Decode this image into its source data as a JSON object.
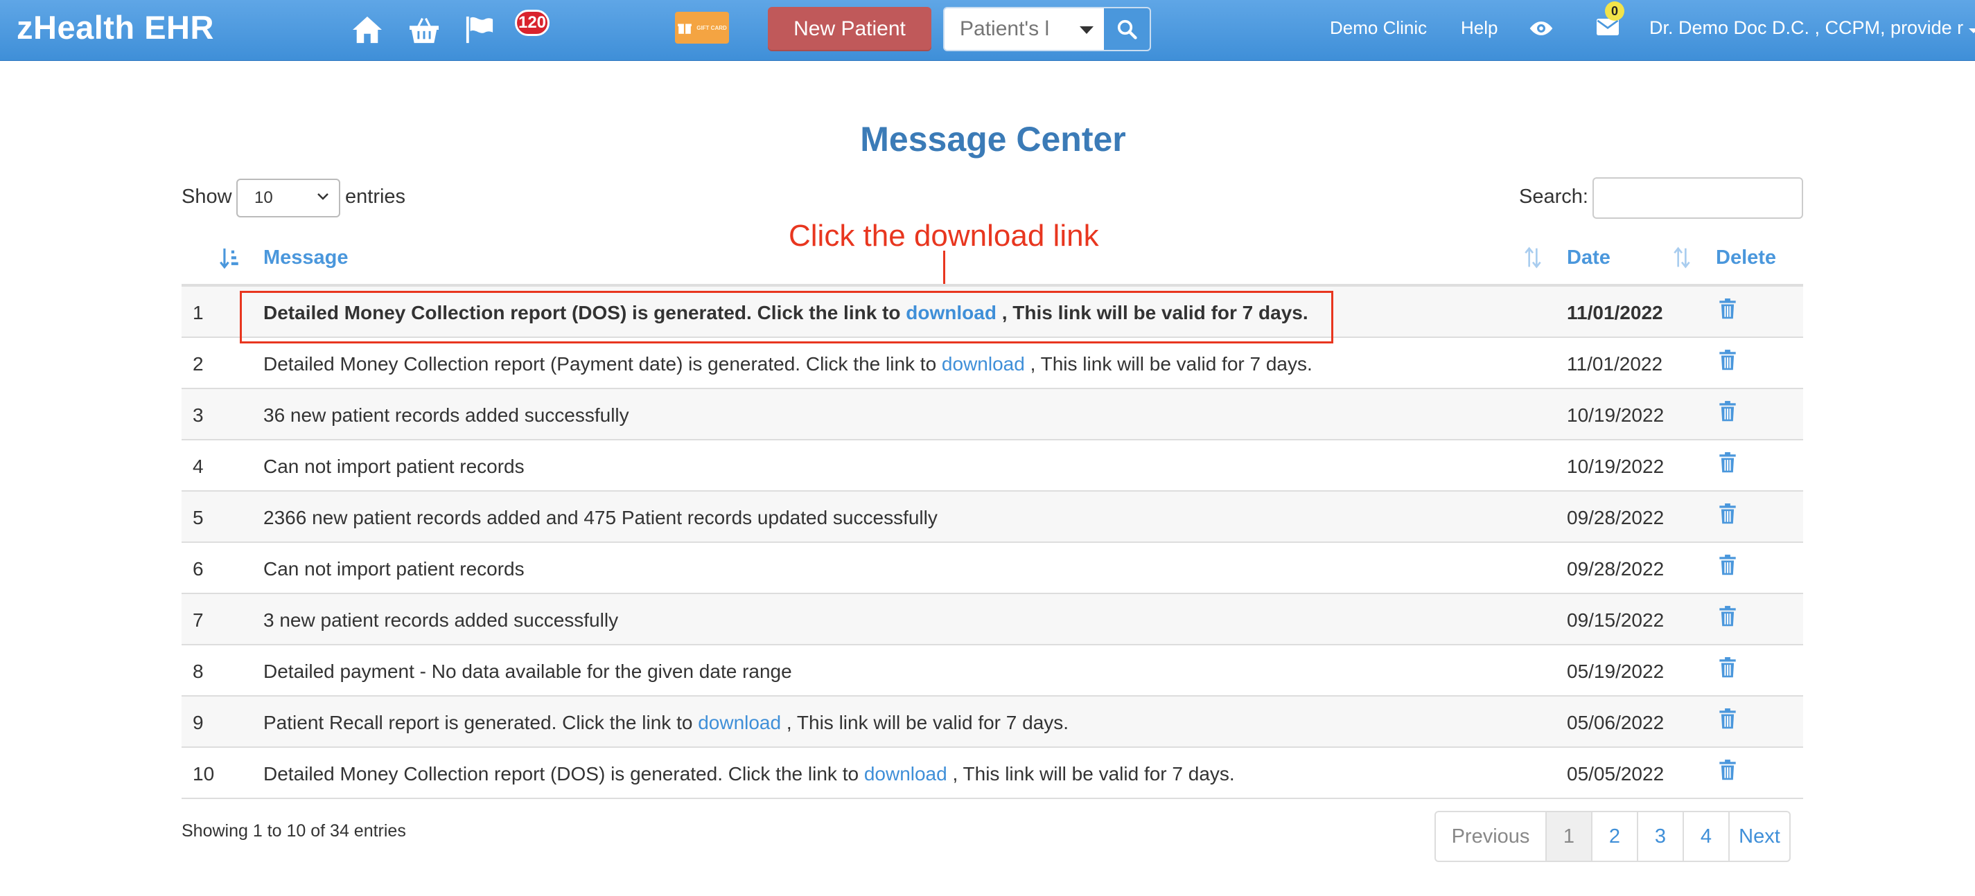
{
  "navbar": {
    "brand": "zHealth EHR",
    "notification_count": "120",
    "new_patient_label": "New Patient",
    "patient_search_placeholder": "Patient's l",
    "links": {
      "clinic": "Demo Clinic",
      "help": "Help"
    },
    "messages_count": "0",
    "user_label": "Dr. Demo Doc D.C. , CCPM, provide r",
    "gift_label": "GIFT CARD",
    "icons": [
      "home-icon",
      "basket-icon",
      "flag-icon",
      "gift-card-icon",
      "search-icon",
      "eye-icon",
      "envelope-icon"
    ]
  },
  "page": {
    "title": "Message Center",
    "show_label": "Show",
    "entries_value": "10",
    "entries_label": "entries",
    "search_label": "Search:",
    "search_value": ""
  },
  "annotation": {
    "text": "Click the download link"
  },
  "table": {
    "headers": {
      "message": "Message",
      "date": "Date",
      "delete": "Delete"
    },
    "link_text": "download",
    "rows": [
      {
        "num": "1",
        "pre": "Detailed Money Collection report (DOS) is generated. Click the link to ",
        "link": "download",
        "post": " , This link will be valid for 7 days.",
        "date": "11/01/2022"
      },
      {
        "num": "2",
        "pre": "Detailed Money Collection report (Payment date) is generated. Click the link to ",
        "link": "download",
        "post": " , This link will be valid for 7 days.",
        "date": "11/01/2022"
      },
      {
        "num": "3",
        "pre": "36 new patient records added successfully",
        "link": "",
        "post": "",
        "date": "10/19/2022"
      },
      {
        "num": "4",
        "pre": "Can not import patient records",
        "link": "",
        "post": "",
        "date": "10/19/2022"
      },
      {
        "num": "5",
        "pre": "2366 new patient records added and 475 Patient records updated successfully",
        "link": "",
        "post": "",
        "date": "09/28/2022"
      },
      {
        "num": "6",
        "pre": "Can not import patient records",
        "link": "",
        "post": "",
        "date": "09/28/2022"
      },
      {
        "num": "7",
        "pre": "3 new patient records added successfully",
        "link": "",
        "post": "",
        "date": "09/15/2022"
      },
      {
        "num": "8",
        "pre": "Detailed payment - No data available for the given date range",
        "link": "",
        "post": "",
        "date": "05/19/2022"
      },
      {
        "num": "9",
        "pre": "Patient Recall report is generated. Click the link to ",
        "link": "download",
        "post": " , This link will be valid for 7 days.",
        "date": "05/06/2022"
      },
      {
        "num": "10",
        "pre": "Detailed Money Collection report (DOS) is generated. Click the link to ",
        "link": "download",
        "post": " , This link will be valid for 7 days.",
        "date": "05/05/2022"
      }
    ]
  },
  "footer": {
    "info": "Showing 1 to 10 of 34 entries",
    "pager": {
      "previous": "Previous",
      "pages": [
        "1",
        "2",
        "3",
        "4"
      ],
      "next": "Next"
    }
  },
  "colors": {
    "navbar": "#4a97dc",
    "new_patient": "#c0595a",
    "title": "#3b7bb7",
    "annotation": "#e8361f",
    "link": "#3f8fd8"
  }
}
